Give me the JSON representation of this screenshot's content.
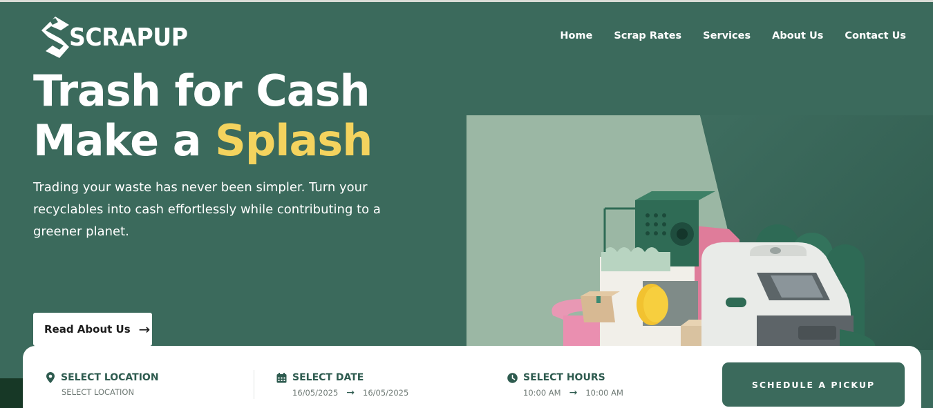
{
  "brand": {
    "name": "SCRAPUP"
  },
  "nav": {
    "items": [
      "Home",
      "Scrap Rates",
      "Services",
      "About Us",
      "Contact Us"
    ]
  },
  "hero": {
    "line1": "Trash for Cash",
    "line2_prefix": "Make a ",
    "line2_accent": "Splash",
    "subtitle": "Trading your waste has never been simpler. Turn your recyclables into cash effortlessly while contributing to a greener planet.",
    "cta_label": "Read About Us"
  },
  "booking": {
    "location": {
      "label": "SELECT LOCATION",
      "value": "SELECT LOCATION"
    },
    "date": {
      "label": "SELECT DATE",
      "from": "16/05/2025",
      "to": "16/05/2025"
    },
    "hours": {
      "label": "SELECT HOURS",
      "from": "10:00 AM",
      "to": "10:00 AM"
    },
    "submit_label": "SCHEDULE A PICKUP"
  },
  "colors": {
    "primary": "#3b6a5c",
    "accent": "#f4d35e",
    "white": "#ffffff"
  }
}
